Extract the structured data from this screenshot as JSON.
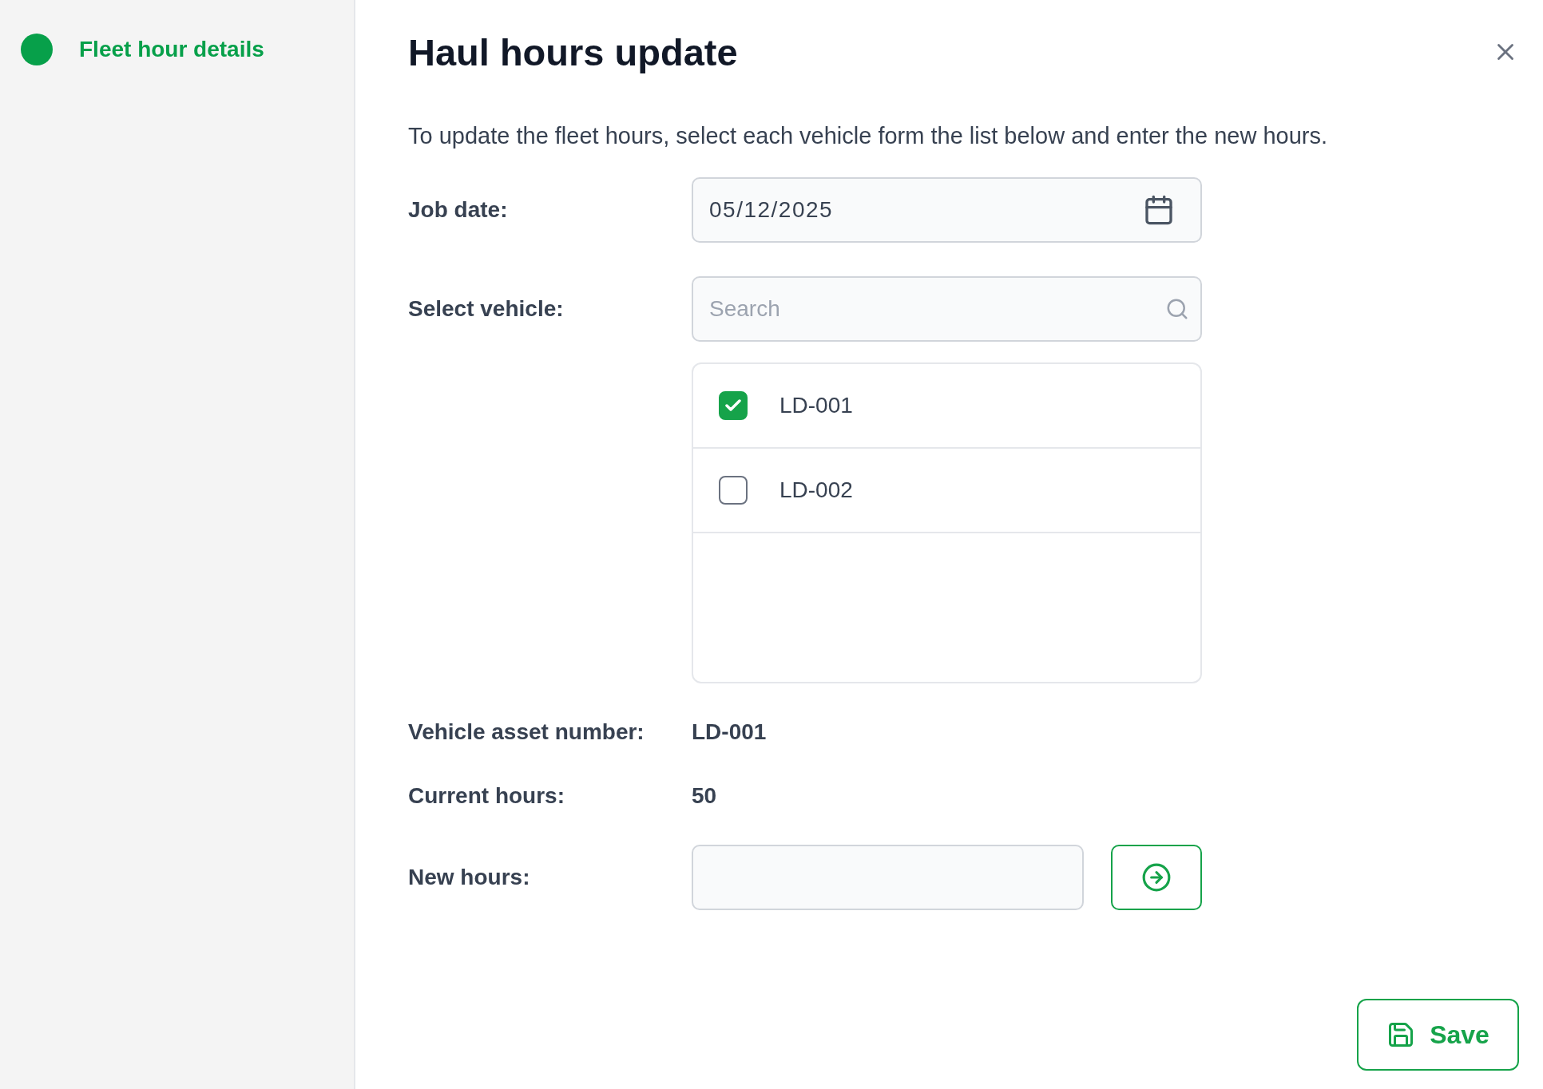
{
  "sidebar": {
    "steps": [
      {
        "label": "Fleet hour details",
        "selected": true
      }
    ]
  },
  "dialog": {
    "title": "Haul hours update",
    "description": "To update the fleet hours, select each vehicle form the list below and enter the new hours.",
    "job_date": {
      "label": "Job date:",
      "value": "05/12/2025"
    },
    "vehicle_select": {
      "label": "Select vehicle:",
      "search": {
        "placeholder": "Search"
      },
      "vehicles": [
        {
          "name": "LD-001",
          "checked": true
        },
        {
          "name": "LD-002",
          "checked": false
        }
      ]
    },
    "details": [
      {
        "label": "Vehicle asset number:",
        "value": "LD-001"
      },
      {
        "label": "Current hours:",
        "value": "50"
      }
    ],
    "new_hours": {
      "label": "New hours:"
    },
    "save_button": {
      "label": "Save"
    }
  }
}
